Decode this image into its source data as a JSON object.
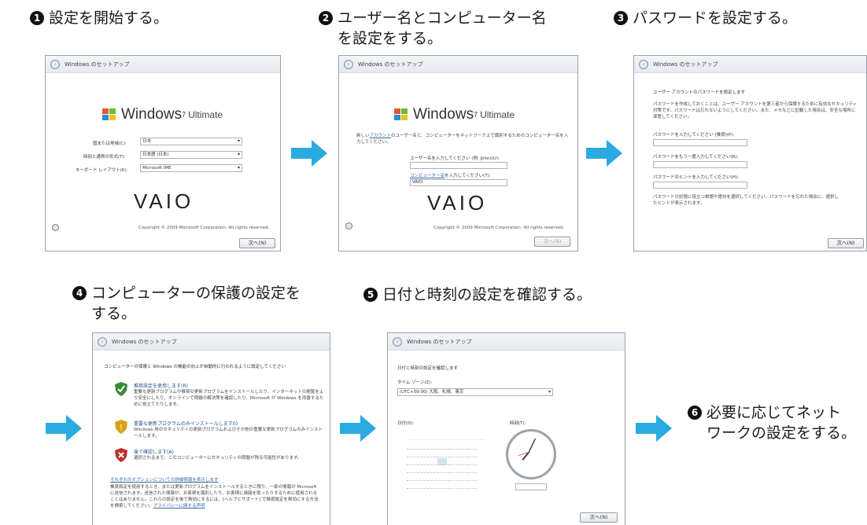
{
  "steps": [
    {
      "num": "1",
      "lines": [
        "設定を開始する。"
      ]
    },
    {
      "num": "2",
      "lines": [
        "ユーザー名とコンピューター名",
        "を設定をする。"
      ]
    },
    {
      "num": "3",
      "lines": [
        "パスワードを設定する。"
      ]
    },
    {
      "num": "4",
      "lines": [
        "コンピューターの保護の設定を",
        "する。"
      ]
    },
    {
      "num": "5",
      "lines": [
        "日付と時刻の設定を確認する。"
      ]
    },
    {
      "num": "6",
      "lines": [
        "必要に応じてネット",
        "ワークの設定をする。"
      ]
    }
  ],
  "arrow_color": "#29abe2",
  "dialog_title": "Windows のセットアップ",
  "windows_logo": {
    "word": "Windows",
    "version": "7",
    "edition": "Ultimate"
  },
  "vaio_logo": "VAIO",
  "copyright": "Copyright © 2009 Microsoft Corporation.  All rights reserved.",
  "next_button": "次へ(N)",
  "screen1": {
    "rows": [
      {
        "label": "国または地域(C):",
        "value": "日本"
      },
      {
        "label": "時刻と通貨の形式(T):",
        "value": "日本語 (日本)"
      },
      {
        "label": "キーボード レイアウト(K):",
        "value": "Microsoft IME"
      }
    ]
  },
  "screen2": {
    "intro_prefix": "新しい",
    "intro_link": "アカウント",
    "intro_rest": "のユーザー名と、コンピューターをネットワーク上で識別するためのコンピューター名を入力してください。",
    "user_label": "ユーザー名を入力してください (例: John)(U):",
    "computer_label_link": "コンピューター名",
    "computer_label_rest": "を入力してください(T):",
    "computer_value": "VAIO"
  },
  "screen3": {
    "heading": "ユーザー アカウントのパスワードを設定します",
    "desc": "パスワードを作成しておくことは、ユーザー アカウントを第三者から保護するために有効なセキュリティ対策です。パスワードは忘れないようにしてください。また、メモなどに記載した場合は、安全な場所に保管してください。",
    "f1": "パスワードを入力してください (推奨)(P):",
    "f2": "パスワードをもう一度入力してください(R):",
    "f3": "パスワードのヒントを入力してください(H):",
    "note": "パスワードの記憶に役立つ単語や語句を選択してください。パスワードを忘れた場合に、選択したヒントが表示されます。"
  },
  "screen4": {
    "heading": "コンピューターの保護と Windows の機能の向上が自動的に行われるように設定してください",
    "options": [
      {
        "title": "推奨設定を使用します(R)",
        "desc": "重要な更新プログラムや推奨の更新プログラムをインストールしたり、インターネットの閲覧をより安全にしたり、オンラインで問題の解決策を確認したり、Microsoft が Windows を改善するために役立てたりします。",
        "color": "#3a8a3a"
      },
      {
        "title": "重要な更新プログラムのみインストールします(I)",
        "desc": "Windows 用のセキュリティの更新プログラムおよびその他の重要な更新プログラムのみインストールします。",
        "color": "#d9a21b"
      },
      {
        "title": "後で確認します(A)",
        "desc": "選択されるまで、このコンピューターにセキュリティの問題が残る可能性があります。",
        "color": "#c03030"
      }
    ],
    "more_link": "それぞれのオプションについての詳細情報を表示します",
    "footer_text": "推奨設定を使用するとき、または更新プログラムをインストールするときに限り、一部の情報が Microsoft に送信されます。送信された情報が、お客様を識別したり、お客様に連絡を取ったりするために使用されることはありません。これらの設定を後で無効にするには、[ヘルプとサポート] で推奨設定を無効にする方法を検索してください。",
    "privacy_link": "プライバシーに関する声明"
  },
  "screen5": {
    "heading": "日付と時刻の設定を確認します",
    "tz_label": "タイム ゾーン(Z):",
    "tz_value": "(UTC+09:00) 大阪、札幌、東京",
    "date_label": "日付(D):",
    "time_label": "時刻(T):"
  }
}
